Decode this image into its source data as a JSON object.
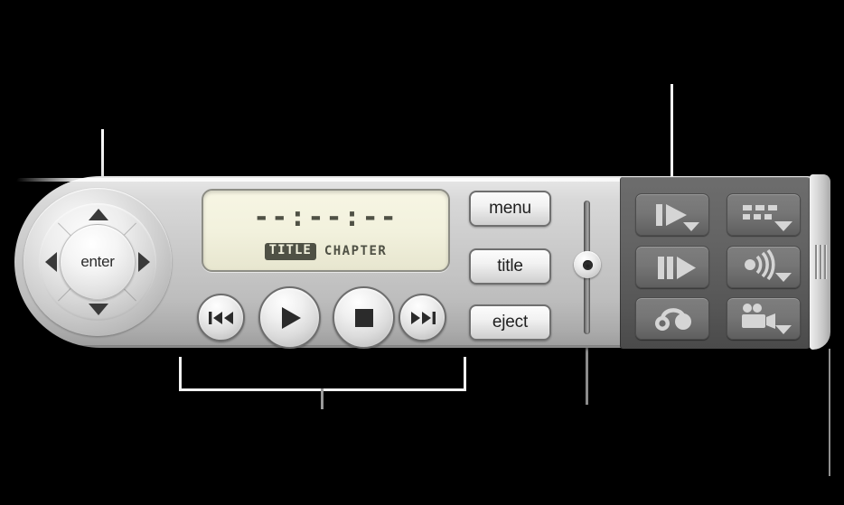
{
  "window": {
    "title": "DVD Player Controller",
    "background_color": "#000000",
    "body_color": "#c9c9c9",
    "dark_panel_color": "#636363"
  },
  "dpad": {
    "name": "navigation-pad",
    "center_label": "enter",
    "up_icon": "triangle-up-icon",
    "down_icon": "triangle-down-icon",
    "left_icon": "triangle-left-icon",
    "right_icon": "triangle-right-icon"
  },
  "lcd": {
    "time": "--:--:--",
    "title_label": "TITLE",
    "chapter_label": "CHAPTER",
    "screen_color": "#f2f1dd",
    "text_color": "#4f5145"
  },
  "transport": [
    {
      "name": "previous-chapter-button",
      "icon": "skip-back-icon",
      "label": "Previous Chapter"
    },
    {
      "name": "play-button",
      "icon": "play-icon",
      "label": "Play"
    },
    {
      "name": "stop-button",
      "icon": "stop-icon",
      "label": "Stop"
    },
    {
      "name": "next-chapter-button",
      "icon": "skip-forward-icon",
      "label": "Next Chapter"
    }
  ],
  "side_buttons": [
    {
      "name": "menu-button",
      "label": "menu"
    },
    {
      "name": "title-button",
      "label": "title"
    },
    {
      "name": "eject-button",
      "label": "eject"
    }
  ],
  "slider": {
    "name": "volume-slider",
    "orientation": "vertical",
    "knob_position_percent": 50
  },
  "panel_buttons": [
    {
      "name": "slow-motion-button",
      "icon": "slow-motion-icon",
      "has_dropdown": true
    },
    {
      "name": "subtitle-button",
      "icon": "subtitle-icon",
      "has_dropdown": true
    },
    {
      "name": "step-frame-button",
      "icon": "step-frame-icon",
      "has_dropdown": false
    },
    {
      "name": "audio-button",
      "icon": "audio-waves-icon",
      "has_dropdown": true
    },
    {
      "name": "bookmark-button",
      "icon": "bookmark-loop-icon",
      "has_dropdown": false
    },
    {
      "name": "camera-angle-button",
      "icon": "video-camera-icon",
      "has_dropdown": true
    }
  ],
  "grip": {
    "name": "resize-grip",
    "icon": "grip-lines-icon"
  },
  "callouts": [
    {
      "name": "callout-navigation-pad",
      "target": "navigation-pad",
      "color": "#ffffff"
    },
    {
      "name": "callout-transport-group",
      "target": "transport-buttons",
      "color": "#f2f2f2"
    },
    {
      "name": "callout-volume-slider",
      "target": "volume-slider",
      "color": "#8b8b8b"
    },
    {
      "name": "callout-panel-buttons",
      "target": "panel-buttons",
      "color": "#f5f5f5"
    },
    {
      "name": "callout-resize-grip",
      "target": "resize-grip",
      "color": "#8e8e8e"
    }
  ]
}
